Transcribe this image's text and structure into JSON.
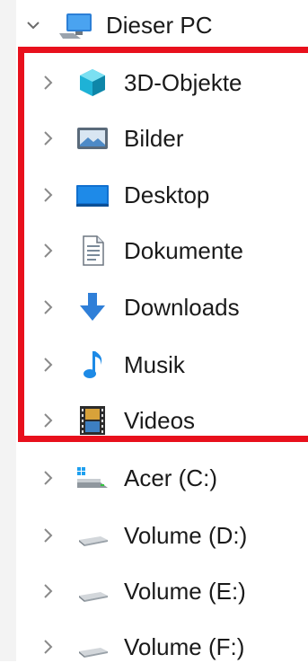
{
  "tree": {
    "root": {
      "label": "Dieser PC",
      "icon": "this-pc-icon",
      "expanded": true
    },
    "folders": [
      {
        "label": "3D-Objekte",
        "icon": "3d-objects-icon"
      },
      {
        "label": "Bilder",
        "icon": "pictures-icon"
      },
      {
        "label": "Desktop",
        "icon": "desktop-icon"
      },
      {
        "label": "Dokumente",
        "icon": "documents-icon"
      },
      {
        "label": "Downloads",
        "icon": "downloads-icon"
      },
      {
        "label": "Musik",
        "icon": "music-icon"
      },
      {
        "label": "Videos",
        "icon": "videos-icon"
      }
    ],
    "drives": [
      {
        "label": "Acer (C:)",
        "icon": "system-drive-icon"
      },
      {
        "label": "Volume (D:)",
        "icon": "drive-icon"
      },
      {
        "label": "Volume (E:)",
        "icon": "drive-icon"
      },
      {
        "label": "Volume (F:)",
        "icon": "drive-icon"
      }
    ]
  },
  "colors": {
    "highlight_border": "#e8101c",
    "chevron": "#8a8a8a",
    "left_strip": "#f3f3f3"
  }
}
